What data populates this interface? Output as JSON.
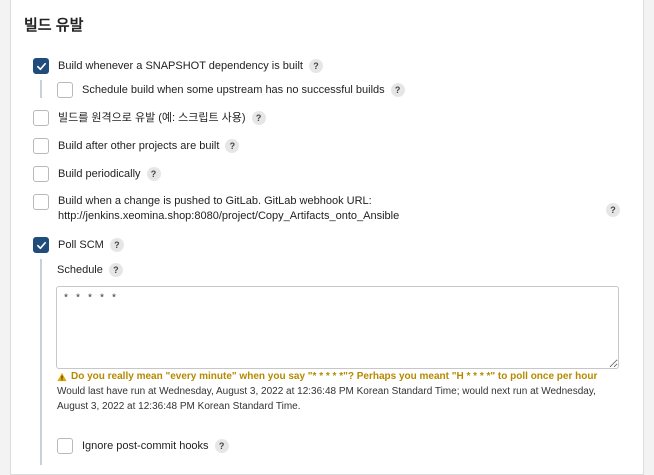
{
  "section": {
    "title": "빌드 유발"
  },
  "help_label": "?",
  "triggers": [
    {
      "label": "Build whenever a SNAPSHOT dependency is built",
      "checked": true
    },
    {
      "label": "Schedule build when some upstream has no successful builds",
      "checked": false
    },
    {
      "label": "빌드를 원격으로 유발 (예: 스크립트 사용)",
      "checked": false
    },
    {
      "label": "Build after other projects are built",
      "checked": false
    },
    {
      "label": "Build periodically",
      "checked": false
    },
    {
      "label": "Build when a change is pushed to GitLab. GitLab webhook URL:",
      "label2": "http://jenkins.xeomina.shop:8080/project/Copy_Artifacts_onto_Ansible",
      "checked": false
    },
    {
      "label": "Poll SCM",
      "checked": true
    },
    {
      "label": "Ignore post-commit hooks",
      "checked": false
    }
  ],
  "poll_scm": {
    "schedule_label": "Schedule",
    "schedule_value": "* * * * *",
    "warning": "Do you really mean \"every minute\" when you say \"* * * * *\"? Perhaps you meant \"H * * * *\" to poll once per hour",
    "info": "Would last have run at Wednesday, August 3, 2022 at 12:36:48 PM Korean Standard Time; would next run at Wednesday, August 3, 2022 at 12:36:48 PM Korean Standard Time."
  }
}
